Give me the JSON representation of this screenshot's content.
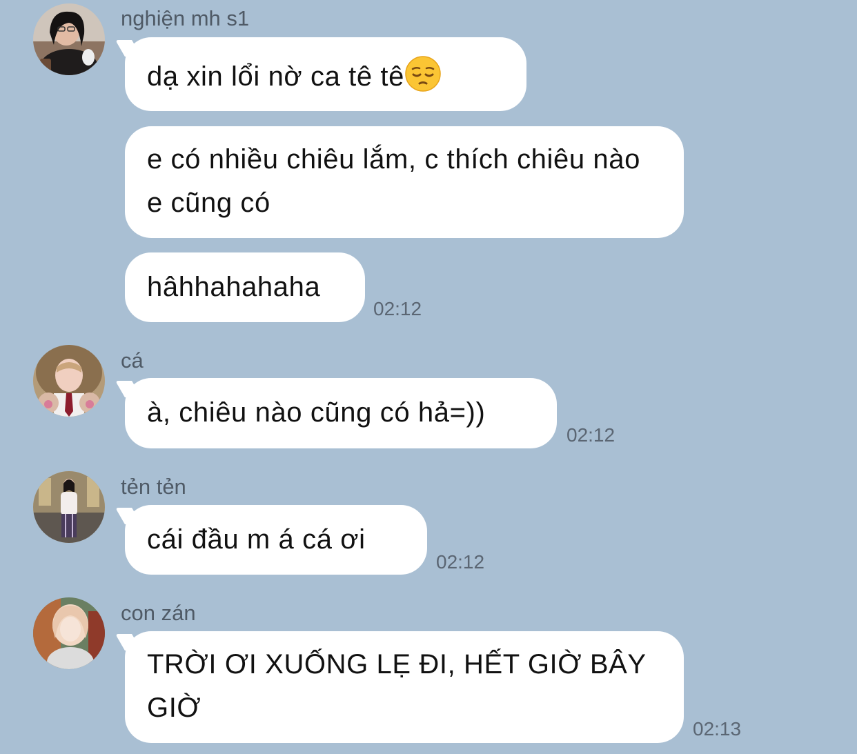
{
  "messages": [
    {
      "sender": "nghiện mh s1",
      "bubbles": [
        {
          "text": "dạ xin lổi nờ ca tê tê",
          "emoji": "pensive-face-icon"
        },
        {
          "text": "e có nhiều chiêu lắm, c thích chiêu nào e cũng có"
        },
        {
          "text": "hâhhahahaha"
        }
      ],
      "time": "02:12"
    },
    {
      "sender": "cá",
      "bubbles": [
        {
          "text": "à, chiêu nào cũng có hả=))"
        }
      ],
      "time": "02:12"
    },
    {
      "sender": "tẻn tẻn",
      "bubbles": [
        {
          "text": "cái đầu m á cá ơi"
        }
      ],
      "time": "02:12"
    },
    {
      "sender": "con zán",
      "bubbles": [
        {
          "text": "TRỜI ƠI XUỐNG LẸ ĐI, HẾT GIỜ BÂY GIỜ"
        }
      ],
      "time": "02:13"
    }
  ],
  "colors": {
    "background": "#a9bfd3",
    "bubble": "#ffffff",
    "sender_text": "#4f5a66",
    "timestamp_text": "#5b6673"
  }
}
